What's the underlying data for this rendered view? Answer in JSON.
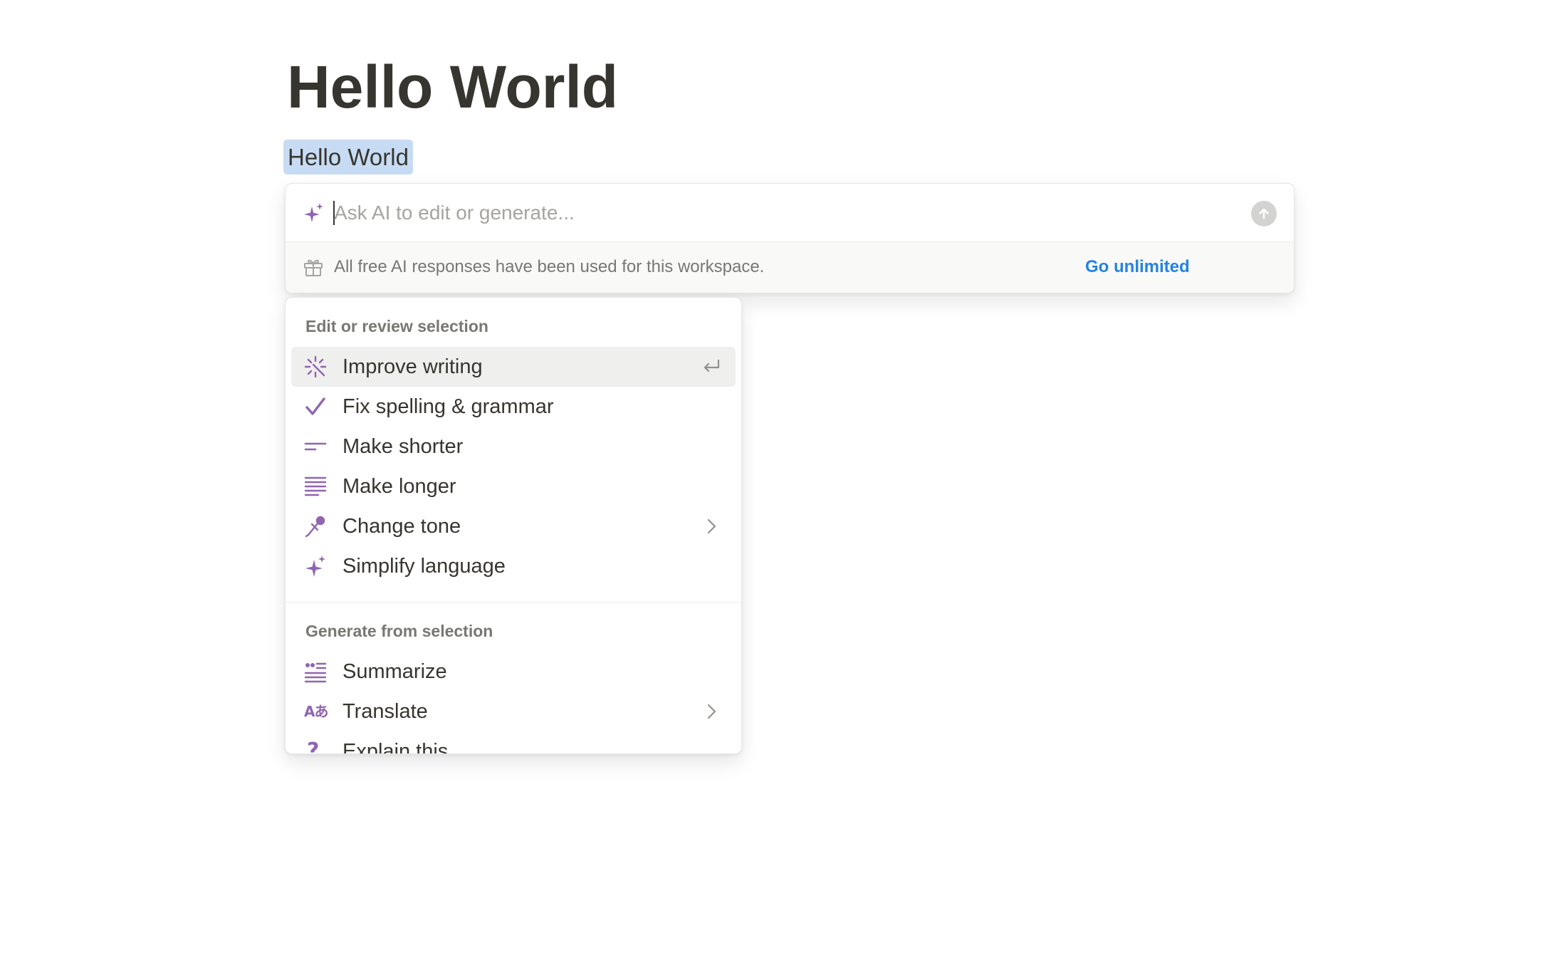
{
  "page": {
    "title": "Hello World",
    "selected_text": "Hello World"
  },
  "ai_prompt": {
    "placeholder": "Ask AI to edit or generate...",
    "value": "",
    "notice_text": "All free AI responses have been used for this workspace.",
    "notice_link": "Go unlimited",
    "icons": {
      "prompt": "ai-sparkle-icon",
      "submit": "arrow-up-icon",
      "notice": "gift-icon"
    }
  },
  "menu": {
    "edit_section": {
      "header": "Edit or review selection",
      "items": [
        {
          "label": "Improve writing",
          "icon": "magic-wand-icon",
          "active": true,
          "right": "enter-key-icon"
        },
        {
          "label": "Fix spelling & grammar",
          "icon": "checkmark-icon"
        },
        {
          "label": "Make shorter",
          "icon": "short-lines-icon"
        },
        {
          "label": "Make longer",
          "icon": "long-lines-icon"
        },
        {
          "label": "Change tone",
          "icon": "mic-icon",
          "right": "chevron-right-icon"
        },
        {
          "label": "Simplify language",
          "icon": "sparkle-icon"
        }
      ]
    },
    "generate_section": {
      "header": "Generate from selection",
      "items": [
        {
          "label": "Summarize",
          "icon": "quote-lines-icon"
        },
        {
          "label": "Translate",
          "icon": "translate-icon",
          "glyph": "Aあ",
          "right": "chevron-right-icon"
        },
        {
          "label": "Explain this",
          "icon": "question-icon",
          "glyph": "?"
        }
      ]
    }
  },
  "colors": {
    "text": "#37352f",
    "muted": "#787774",
    "accent_purple": "#9065b0",
    "link_blue": "#2383e2",
    "selection": "#c7dcf4",
    "hover": "#efefee"
  }
}
